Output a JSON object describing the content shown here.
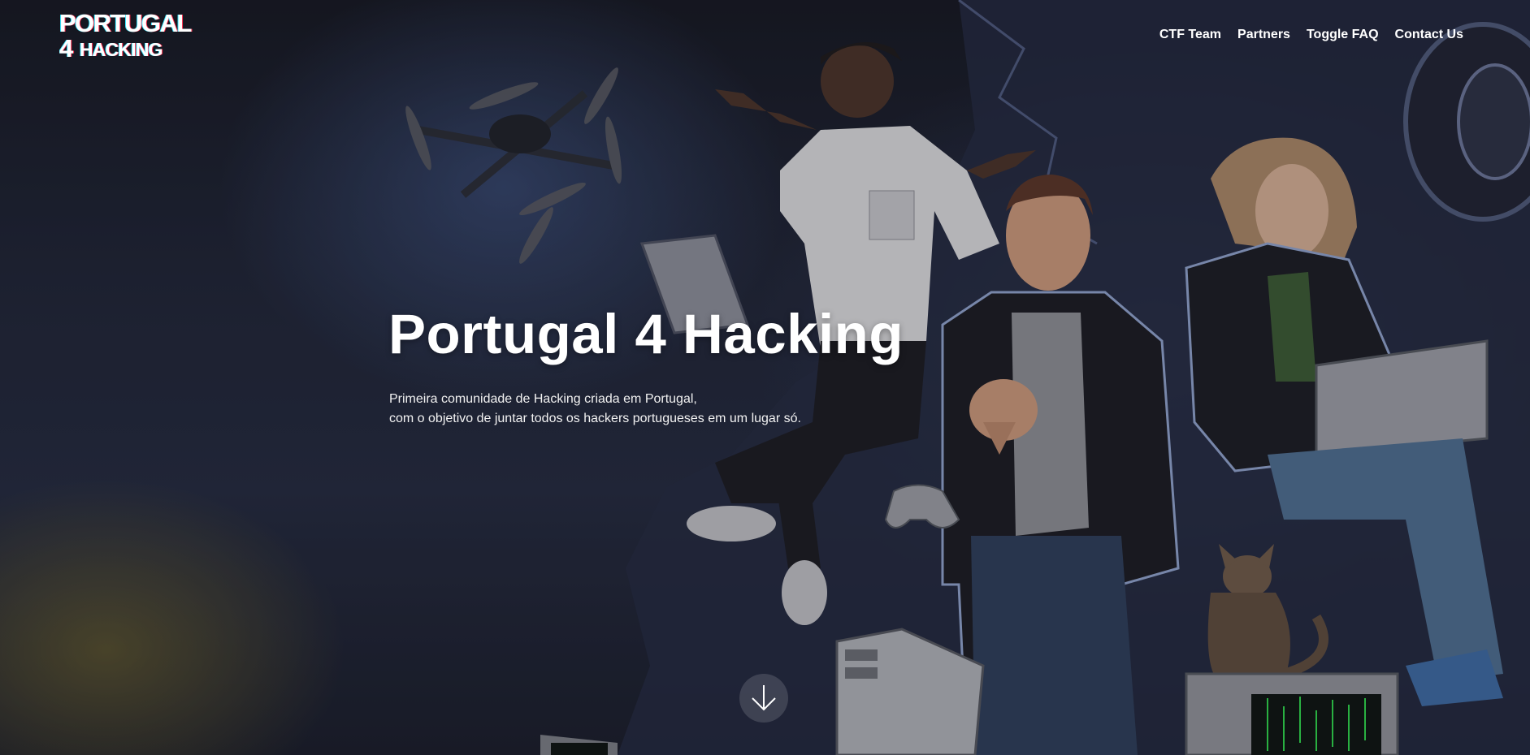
{
  "logo": {
    "line1": "PORTUGAL",
    "line2_prefix": "4",
    "line2_word": "HACKING"
  },
  "nav": {
    "items": [
      {
        "label": "CTF Team"
      },
      {
        "label": "Partners"
      },
      {
        "label": "Toggle FAQ"
      },
      {
        "label": "Contact Us"
      }
    ]
  },
  "hero": {
    "title": "Portugal 4 Hacking",
    "subtitle_line1": "Primeira comunidade de Hacking criada em Portugal,",
    "subtitle_line2": "com o objetivo de juntar todos os hackers portugueses em um lugar só."
  },
  "scroll": {
    "icon": "arrow-down-icon"
  },
  "colors": {
    "background": "#1b1e2b",
    "text": "#ffffff",
    "logo_red": "#ff2a4a",
    "logo_cyan": "#38e6ff"
  }
}
